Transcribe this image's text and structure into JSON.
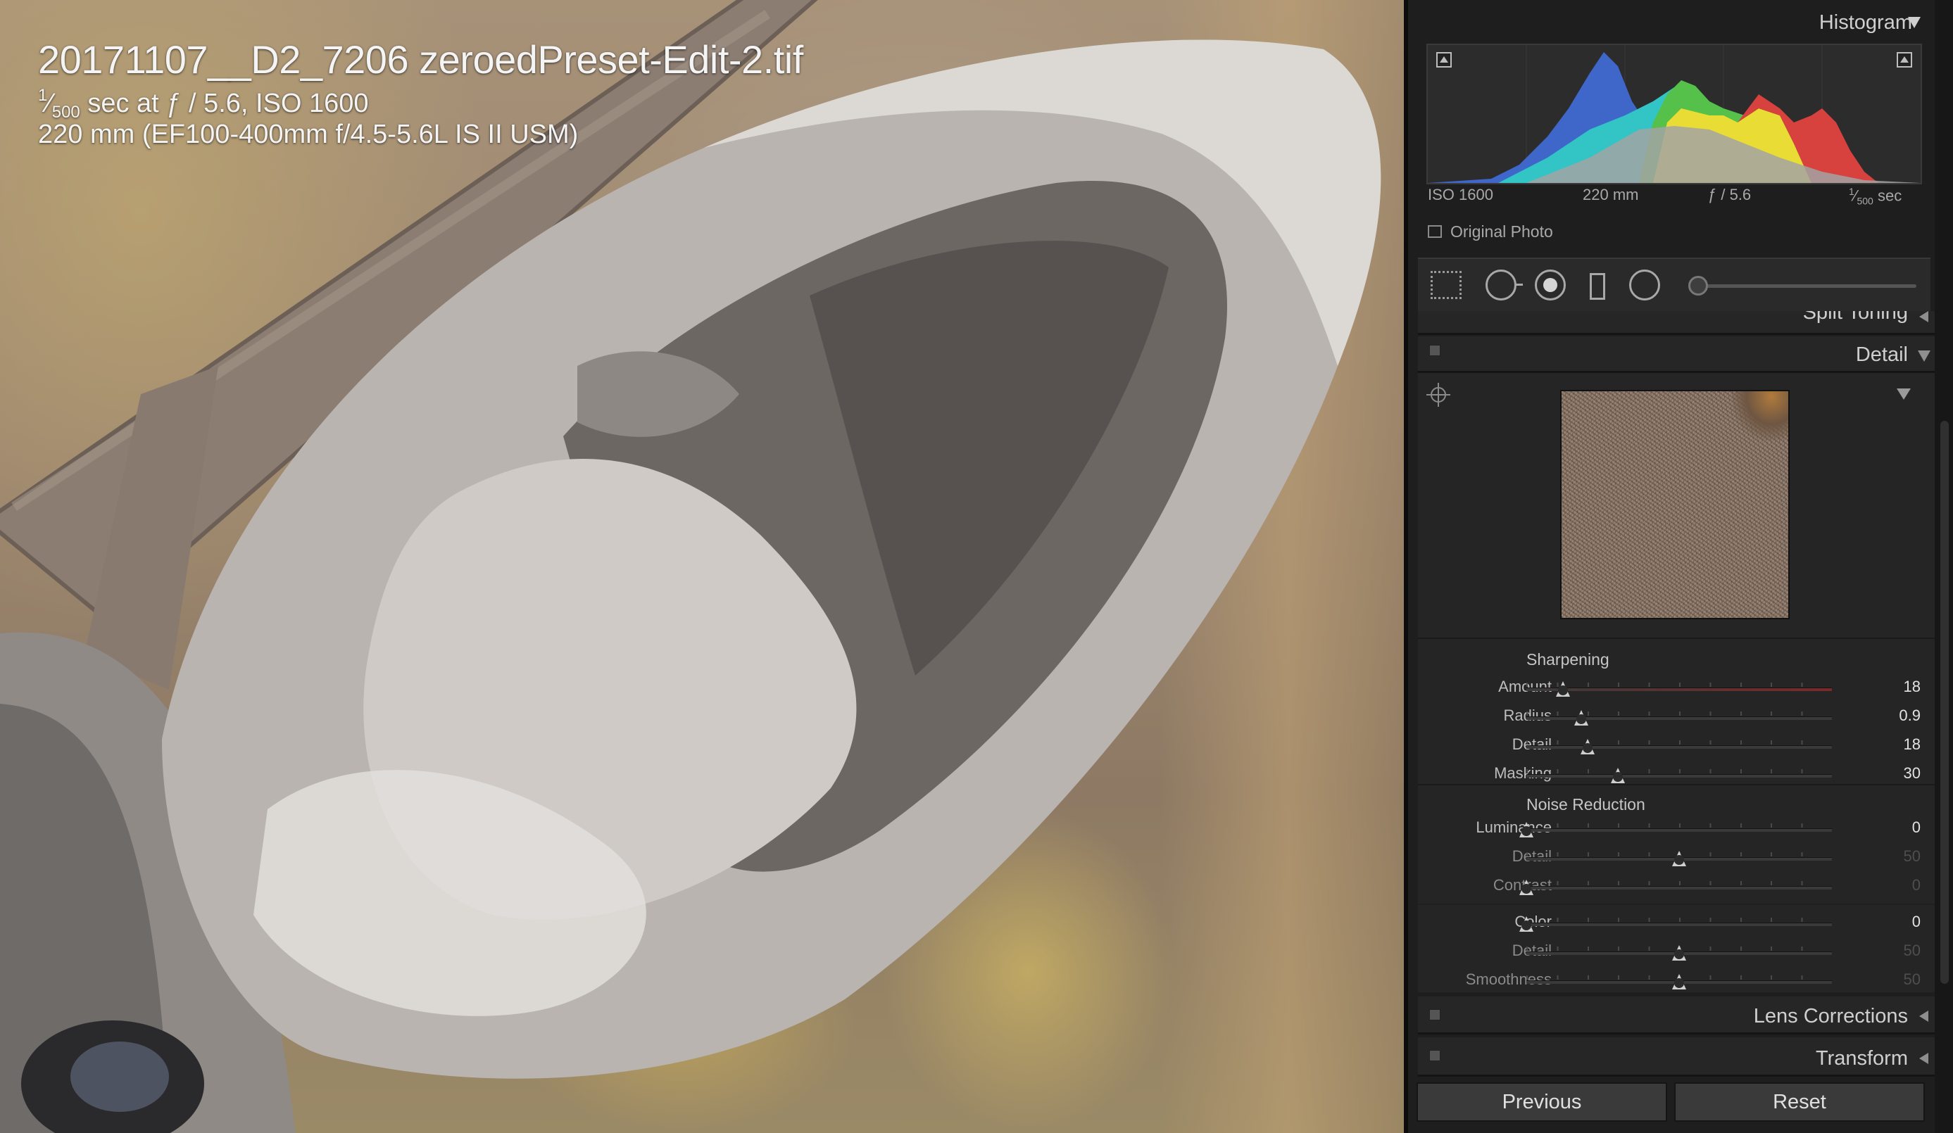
{
  "photo": {
    "title": "20171107__D2_7206 zeroedPreset-Edit-2.tif",
    "shutter_num": "1",
    "shutter_den": "500",
    "line2_rest": " sec at ƒ / 5.6, ISO 1600",
    "line3": "220 mm (EF100-400mm f/4.5-5.6L IS II USM)"
  },
  "histogram": {
    "title": "Histogram",
    "exif_iso": "ISO 1600",
    "exif_focal": "220 mm",
    "exif_aperture": "ƒ / 5.6",
    "exif_shutter_num": "1",
    "exif_shutter_den": "500",
    "exif_shutter_unit": " sec",
    "original_photo_label": "Original Photo"
  },
  "sections": {
    "split_toning": "Split Toning",
    "detail": "Detail",
    "lens_corrections": "Lens Corrections",
    "transform": "Transform"
  },
  "sharpening": {
    "title": "Sharpening",
    "sliders": [
      {
        "label": "Amount",
        "value": "18",
        "fraction": 0.12
      },
      {
        "label": "Radius",
        "value": "0.9",
        "fraction": 0.18
      },
      {
        "label": "Detail",
        "value": "18",
        "fraction": 0.2
      },
      {
        "label": "Masking",
        "value": "30",
        "fraction": 0.3
      }
    ]
  },
  "noise_reduction": {
    "title": "Noise Reduction",
    "luminance": [
      {
        "label": "Luminance",
        "value": "0",
        "fraction": 0.0
      },
      {
        "label": "Detail",
        "value": "50",
        "fraction": 0.5
      },
      {
        "label": "Contrast",
        "value": "0",
        "fraction": 0.0
      }
    ],
    "color": [
      {
        "label": "Color",
        "value": "0",
        "fraction": 0.0
      },
      {
        "label": "Detail",
        "value": "50",
        "fraction": 0.5
      },
      {
        "label": "Smoothness",
        "value": "50",
        "fraction": 0.5
      }
    ]
  },
  "buttons": {
    "previous": "Previous",
    "reset": "Reset"
  },
  "icons": [
    "crop-overlay-icon",
    "spot-removal-icon",
    "red-eye-icon",
    "graduated-filter-icon",
    "radial-filter-icon",
    "adjustment-brush-icon",
    "target-adjust-icon"
  ],
  "colors": {
    "panel_bg": "#1e1e1e",
    "amount_track_red": "#7a2a2a",
    "histo_blue": "#3f66c9",
    "histo_cyan": "#33c5c5",
    "histo_green": "#55c04a",
    "histo_yellow": "#e8dc35",
    "histo_red": "#d8423e",
    "histo_gray": "#a3a3a3"
  }
}
